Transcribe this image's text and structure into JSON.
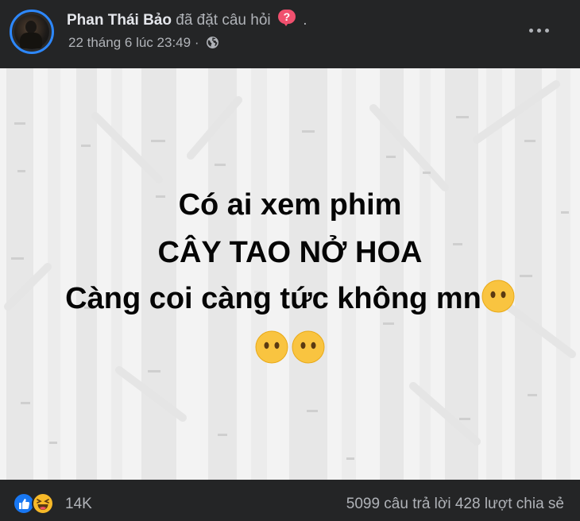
{
  "post": {
    "author": "Phan Thái Bảo",
    "action": "đã đặt câu hỏi",
    "question_badge": "?",
    "action_suffix": ".",
    "timestamp": "22 tháng 6 lúc 23:49",
    "meta_separator": "·",
    "privacy_icon": "globe-icon",
    "more_icon": "ellipsis-icon",
    "background_color": "#f3f3f3",
    "text_lines": [
      "Có ai xem phim",
      "CÂY TAO NỞ HOA",
      "Càng coi càng tức không mn"
    ],
    "emoji": "face-without-mouth-emoji"
  },
  "footer": {
    "reactions": [
      "like-icon",
      "haha-icon"
    ],
    "reaction_count": "14K",
    "answers": "5099 câu trả lời",
    "shares": "428 lượt chia sẻ"
  },
  "colors": {
    "accent": "#2d88ff",
    "like": "#1877f2",
    "haha": "#f7b928",
    "question_badge": "#f0506e",
    "dark_bg": "#242526"
  }
}
